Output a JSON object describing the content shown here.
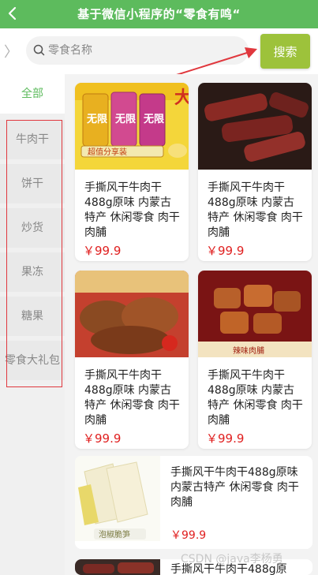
{
  "header": {
    "title": "基于微信小程序的“零食有鸣“",
    "back_icon": "chevron-left-icon"
  },
  "search": {
    "placeholder": "零食名称",
    "button_label": "搜索",
    "expand_glyph": "〉"
  },
  "sidebar": {
    "items": [
      {
        "label": "全部",
        "active": true
      },
      {
        "label": "牛肉干"
      },
      {
        "label": "饼干"
      },
      {
        "label": "炒货"
      },
      {
        "label": "果冻"
      },
      {
        "label": "糖果"
      },
      {
        "label": "零食大礼包"
      }
    ]
  },
  "products": [
    {
      "name": "手撕风干牛肉干488g原味 内蒙古特产 休闲零食 肉干肉脯",
      "price": "￥99.9"
    },
    {
      "name": "手撕风干牛肉干488g原味 内蒙古特产 休闲零食 肉干肉脯",
      "price": "￥99.9"
    },
    {
      "name": "手撕风干牛肉干488g原味 内蒙古特产 休闲零食 肉干肉脯",
      "price": "￥99.9"
    },
    {
      "name": "手撕风干牛肉干488g原味 内蒙古特产 休闲零食 肉干肉脯",
      "price": "￥99.9"
    },
    {
      "name": "手撕风干牛肉干488g原味 内蒙古特产 休闲零食 肉干肉脯",
      "price": "￥99.9"
    },
    {
      "name": "手撕风干牛肉干488g原",
      "price": ""
    }
  ],
  "image_labels": {
    "chips_tag": "超值分享装",
    "spicy_tag": "辣味肉脯",
    "bamboo_tag": "泡椒脆笋"
  },
  "watermark": "CSDN @java李杨勇",
  "colors": {
    "header": "#5dbb5d",
    "search_button": "#9dc23b",
    "price": "#e02020",
    "annotation": "#e0383e"
  }
}
